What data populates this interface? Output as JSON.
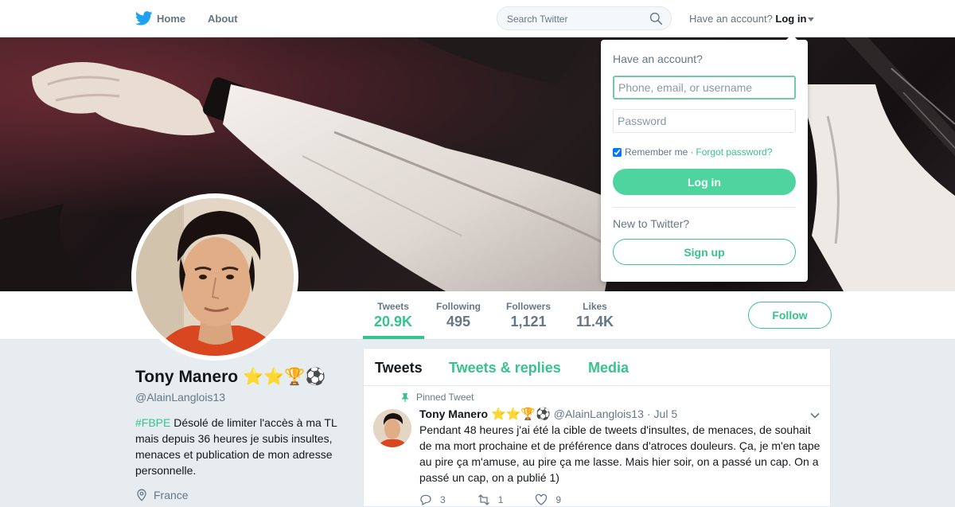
{
  "nav": {
    "home_label": "Home",
    "about_label": "About",
    "search_placeholder": "Search Twitter",
    "have_account": "Have an account?",
    "login_label": "Log in",
    "brand_color": "#1da1f2"
  },
  "profile": {
    "name": "Tony Manero",
    "name_emoji": "⭐⭐🏆⚽",
    "handle": "@AlainLanglois13",
    "bio_hashtag": "#FBPE",
    "bio_text": " Désolé de limiter l'accès à ma TL mais depuis 36 heures je subis insultes, menaces et publication de mon adresse personnelle.",
    "location": "France",
    "accent_color": "#38c28e"
  },
  "stats": [
    {
      "label": "Tweets",
      "value": "20.9K"
    },
    {
      "label": "Following",
      "value": "495"
    },
    {
      "label": "Followers",
      "value": "1,121"
    },
    {
      "label": "Likes",
      "value": "11.4K"
    }
  ],
  "follow_label": "Follow",
  "timeline": {
    "tabs": [
      "Tweets",
      "Tweets & replies",
      "Media"
    ],
    "pinned_label": "Pinned Tweet",
    "tweet": {
      "name": "Tony Manero",
      "emoji": "⭐⭐🏆⚽",
      "handle": "@AlainLanglois13",
      "separator": "·",
      "date": "Jul 5",
      "text": "Pendant 48 heures j'ai été la cible de tweets d'insultes, de menaces, de souhait de ma mort prochaine et de préférence dans d'atroces douleurs. Ça, je m'en tape au pire ça m'amuse, au pire ça me lasse. Mais hier soir, on a passé un cap. On a passé un cap, on a publié 1)",
      "reply_count": "3",
      "retweet_count": "1",
      "like_count": "9"
    }
  },
  "login_dropdown": {
    "heading": "Have an account?",
    "username_placeholder": "Phone, email, or username",
    "password_placeholder": "Password",
    "remember_label": "Remember me",
    "separator": "·",
    "forgot_label": "Forgot password?",
    "login_button": "Log in",
    "new_heading": "New to Twitter?",
    "signup_button": "Sign up"
  }
}
